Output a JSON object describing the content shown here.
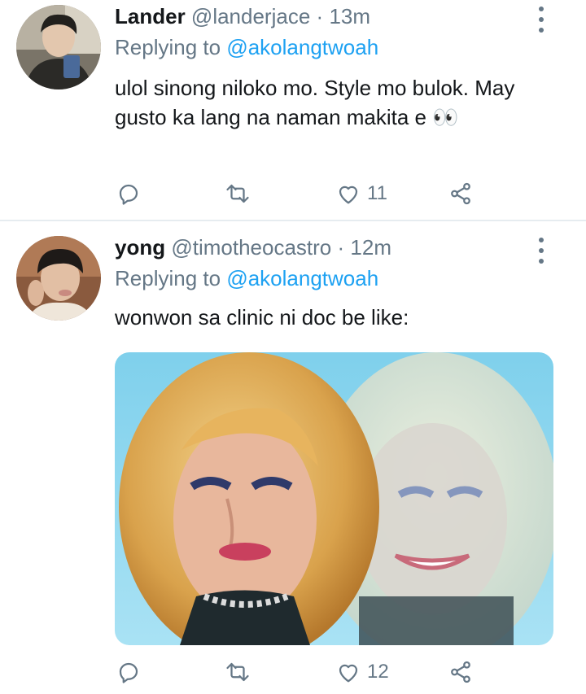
{
  "tweets": [
    {
      "name": "Lander",
      "handle": "@landerjace",
      "separator": "·",
      "time": "13m",
      "replying_prefix": "Replying to",
      "replying_to": "@akolangtwoah",
      "text": "ulol sinong niloko mo. Style mo bulok. May gusto ka lang na naman makita e 👀",
      "reply_count": "",
      "retweet_count": "",
      "like_count": "11"
    },
    {
      "name": "yong",
      "handle": "@timotheocastro",
      "separator": "·",
      "time": "12m",
      "replying_prefix": "Replying to",
      "replying_to": "@akolangtwoah",
      "text": "wonwon sa clinic ni doc be like:",
      "reply_count": "",
      "retweet_count": "",
      "like_count": "12"
    }
  ],
  "icons": [
    "more-vertical-icon",
    "reply-icon",
    "retweet-icon",
    "like-icon",
    "share-icon"
  ],
  "colors": {
    "link": "#1da1f2",
    "secondary": "#657786",
    "text": "#14171a",
    "divider": "#e6ecf0"
  }
}
